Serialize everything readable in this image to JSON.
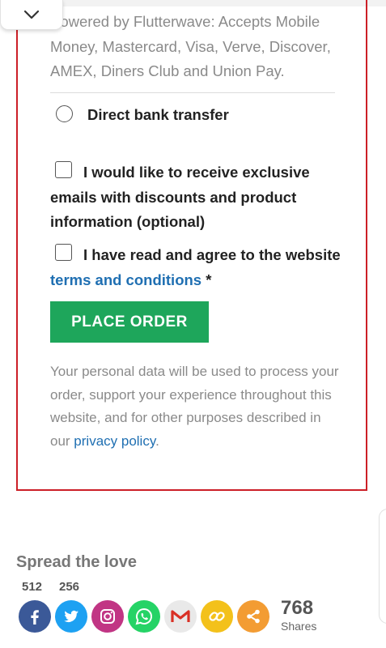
{
  "payment": {
    "gateway_description": "Powered by Flutterwave: Accepts Mobile Money, Mastercard, Visa, Verve, Discover, AMEX, Diners Club and Union Pay.",
    "direct_bank_transfer_label": "Direct bank transfer"
  },
  "consents": {
    "marketing_label": "I would like to receive exclusive emails with discounts and product information (optional)",
    "terms_prefix": "I have read and agree to the website",
    "terms_link": "terms and conditions",
    "required_marker": "*"
  },
  "place_order_label": "PLACE ORDER",
  "privacy": {
    "text_before": "Your personal data will be used to process your order, support your experience throughout this website, and for other purposes described in our ",
    "link_text": "privacy policy",
    "text_after": "."
  },
  "social": {
    "title": "Spread the love",
    "counts": {
      "facebook": "512",
      "twitter": "256"
    },
    "buttons": [
      {
        "name": "facebook",
        "icon": "facebook-icon",
        "color": "#3b5998"
      },
      {
        "name": "twitter",
        "icon": "twitter-icon",
        "color": "#1da1f2"
      },
      {
        "name": "instagram",
        "icon": "instagram-icon",
        "color": "#c13584"
      },
      {
        "name": "whatsapp",
        "icon": "whatsapp-icon",
        "color": "#25d366"
      },
      {
        "name": "gmail",
        "icon": "gmail-icon",
        "color": "#e9e9e9"
      },
      {
        "name": "copy-link",
        "icon": "link-icon",
        "color": "#f3c11b"
      },
      {
        "name": "share",
        "icon": "share-icon",
        "color": "#f39c33"
      }
    ],
    "total_shares": "768",
    "total_label": "Shares"
  },
  "colors": {
    "accent_border": "#cc1f27",
    "button_green": "#1ea65b",
    "link_blue": "#1f6fb2"
  }
}
